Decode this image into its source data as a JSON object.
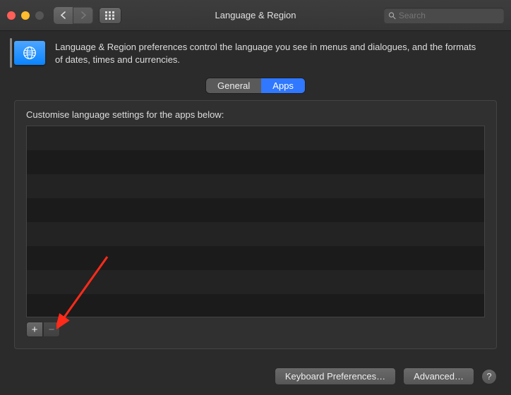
{
  "window": {
    "title": "Language & Region"
  },
  "search": {
    "placeholder": "Search"
  },
  "header": {
    "description": "Language & Region preferences control the language you see in menus and dialogues, and the formats of dates, times and currencies."
  },
  "tabs": {
    "general": "General",
    "apps": "Apps",
    "active": "apps"
  },
  "panel": {
    "label": "Customise language settings for the apps below:",
    "apps": []
  },
  "buttons": {
    "add": "+",
    "remove": "−",
    "keyboard": "Keyboard Preferences…",
    "advanced": "Advanced…",
    "help": "?"
  },
  "annotation": {
    "arrow_points_to": "add-button"
  }
}
